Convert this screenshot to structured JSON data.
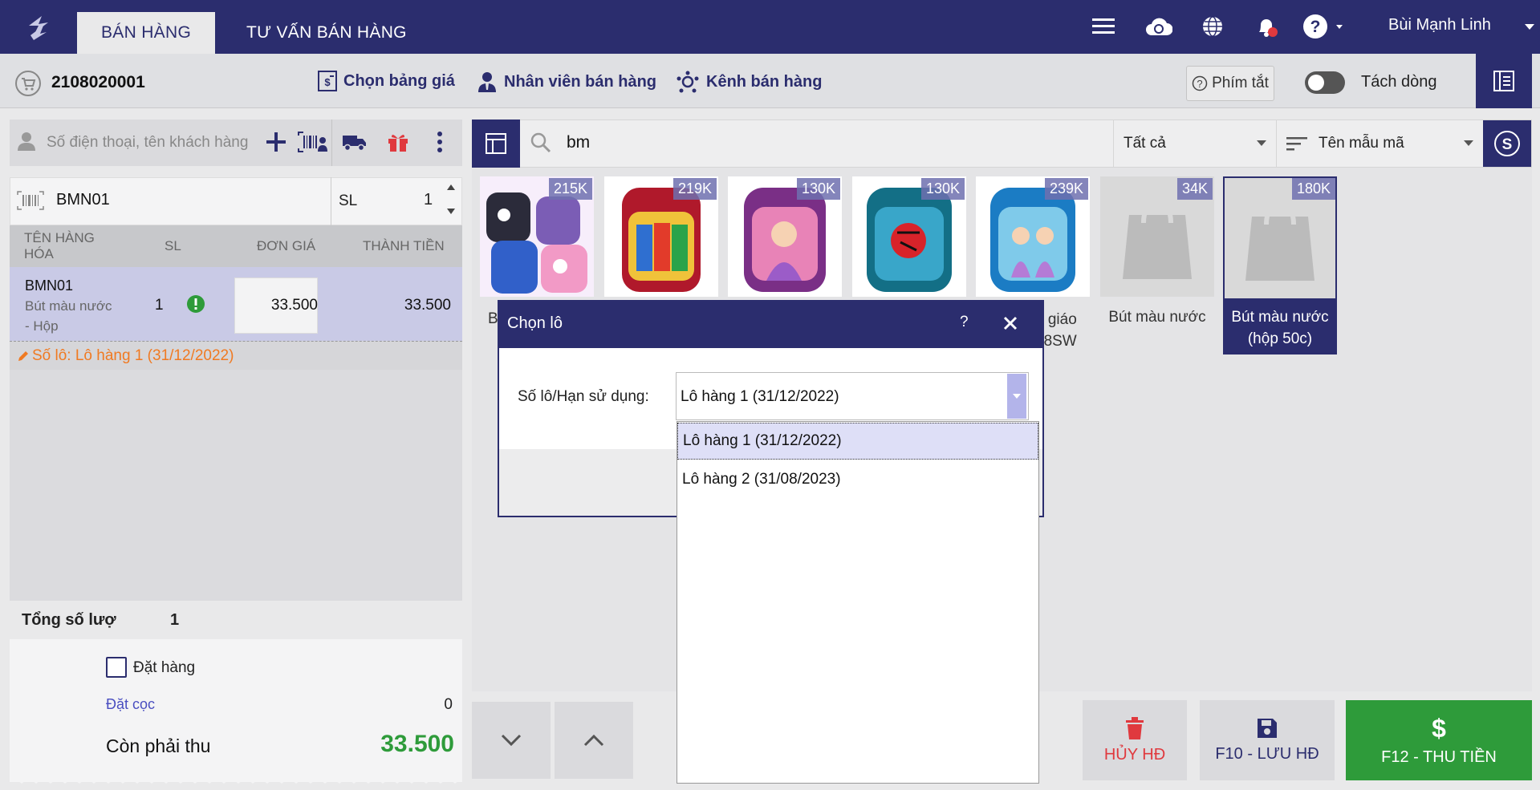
{
  "topbar": {
    "tabs": [
      {
        "label": "BÁN HÀNG"
      },
      {
        "label": "TƯ VẤN BÁN HÀNG"
      }
    ],
    "user_name": "Bùi Mạnh Linh",
    "icons": [
      "menu-icon",
      "cloud-sync-icon",
      "globe-icon",
      "bell-icon",
      "help-icon"
    ]
  },
  "subbar": {
    "order_no": "2108020001",
    "price_list": "Chọn bảng giá",
    "sales_staff": "Nhân viên bán hàng",
    "sales_channel": "Kênh bán hàng",
    "shortcut": "Phím tắt",
    "split_lines": "Tách dòng"
  },
  "left": {
    "customer_placeholder": "Số điện thoại, tên khách hàng",
    "sku_value": "BMN01",
    "qty_label": "SL",
    "qty_value": "1",
    "columns": {
      "name": "TÊN HÀNG HÓA",
      "qty": "SL",
      "price": "ĐƠN GIÁ",
      "total": "THÀNH TIỀN"
    },
    "cart": [
      {
        "code": "BMN01",
        "name": "Bút màu nước - Hộp",
        "qty": "1",
        "price": "33.500",
        "total": "33.500",
        "lot": "Số lô: Lô hàng 1 (31/12/2022)"
      }
    ],
    "total_qty_label": "Tổng số lượ",
    "total_qty_value": "1",
    "order_checkbox": "Đặt hàng",
    "deposit_label": "Đặt cọc",
    "deposit_value": "0",
    "remaining_label": "Còn phải thu",
    "remaining_value": "33.500"
  },
  "products": {
    "search_value": "bm",
    "filter_all": "Tất cả",
    "sort_by": "Tên mẫu mã",
    "items": [
      {
        "price": "215K",
        "name": "B"
      },
      {
        "price": "219K",
        "name": ""
      },
      {
        "price": "130K",
        "name": ""
      },
      {
        "price": "130K",
        "name": ""
      },
      {
        "price": "239K",
        "name": "u giáo 38SW"
      },
      {
        "price": "34K",
        "name": "Bút màu nước"
      },
      {
        "price": "180K",
        "name": "Bút màu nước (hộp 50c)"
      }
    ]
  },
  "actions": {
    "cancel": "HỦY HĐ",
    "save": "F10 - LƯU HĐ",
    "pay": "F12 - THU TIỀN"
  },
  "modal": {
    "title": "Chọn lô",
    "help": "?",
    "field_label": "Số lô/Hạn sử dụng:",
    "selected": "Lô hàng 1 (31/12/2022)",
    "options": [
      "Lô hàng 1 (31/12/2022)",
      "Lô hàng 2 (31/08/2023)"
    ]
  },
  "colors": {
    "brand": "#2b2d6e",
    "pay_green": "#2e9b3a",
    "cancel_red": "#e0393e",
    "lot_orange": "#f07a22"
  }
}
